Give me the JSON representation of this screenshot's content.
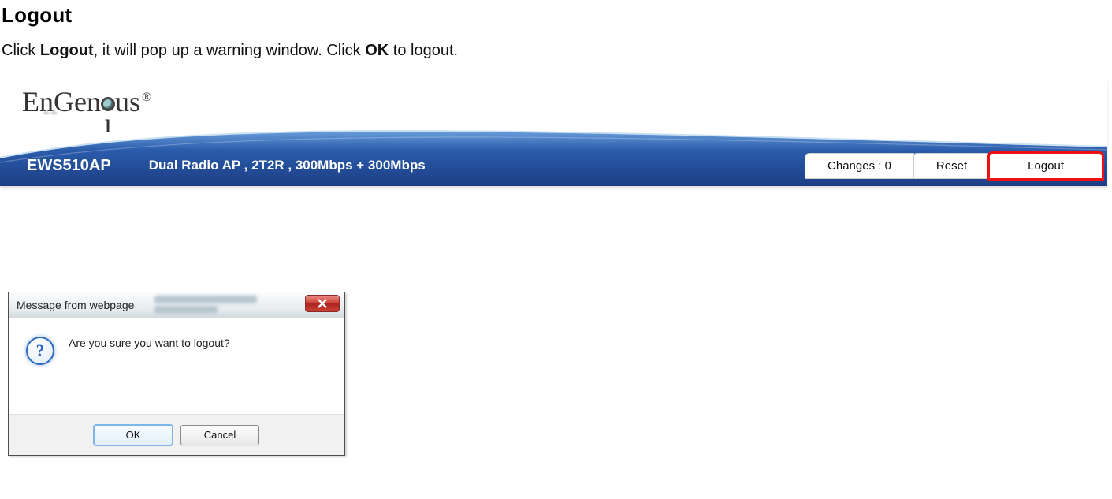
{
  "page": {
    "title": "Logout",
    "desc_pre": "Click ",
    "desc_b1": "Logout",
    "desc_mid": ", it will pop up a warning window. Click ",
    "desc_b2": "OK",
    "desc_post": " to logout."
  },
  "header": {
    "brand_pre": "EnGen",
    "brand_post": "us",
    "brand_reg": "®",
    "model": "EWS510AP",
    "subdesc": "Dual Radio AP , 2T2R , 300Mbps + 300Mbps",
    "changes_label": "Changes : 0",
    "reset_label": "Reset",
    "logout_label": "Logout"
  },
  "dialog": {
    "title": "Message from webpage",
    "message": "Are you sure you want to logout?",
    "ok_label": "OK",
    "cancel_label": "Cancel",
    "question_glyph": "?"
  }
}
